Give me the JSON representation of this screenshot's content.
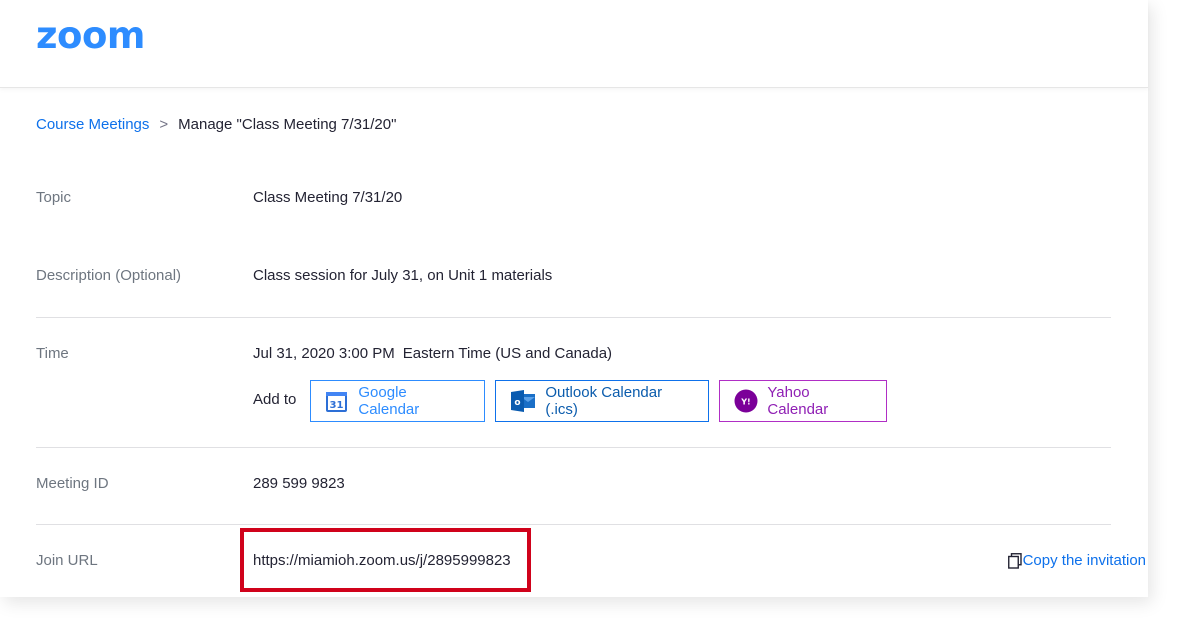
{
  "header": {
    "logo_text": "zoom"
  },
  "breadcrumb": {
    "parent": "Course Meetings",
    "separator": ">",
    "current": "Manage \"Class Meeting 7/31/20\""
  },
  "fields": {
    "topic": {
      "label": "Topic",
      "value": "Class Meeting 7/31/20"
    },
    "description": {
      "label": "Description (Optional)",
      "value": "Class session for July 31, on Unit 1 materials"
    },
    "time": {
      "label": "Time",
      "value": "Jul 31, 2020 3:00 PM",
      "timezone": "Eastern Time (US and Canada)"
    },
    "meeting_id": {
      "label": "Meeting ID",
      "value": "289 599 9823"
    },
    "join_url": {
      "label": "Join URL",
      "value": "https://miamioh.zoom.us/j/2895999823"
    }
  },
  "calendar": {
    "add_to_label": "Add to",
    "google": {
      "label": "Google Calendar",
      "icon": "google-calendar-icon",
      "icon_text": "31",
      "color": "#2d8cff"
    },
    "outlook": {
      "label": "Outlook Calendar (.ics)",
      "icon": "outlook-icon",
      "icon_text": "o",
      "color": "#0e71eb"
    },
    "yahoo": {
      "label": "Yahoo Calendar",
      "icon": "yahoo-icon",
      "icon_text": "Y!",
      "color": "#8f1fb4"
    }
  },
  "copy_invitation": {
    "label": "Copy the invitation",
    "icon": "copy-icon"
  },
  "colors": {
    "brand": "#2d8cff",
    "link": "#0e71eb",
    "highlight": "#d0021b"
  }
}
